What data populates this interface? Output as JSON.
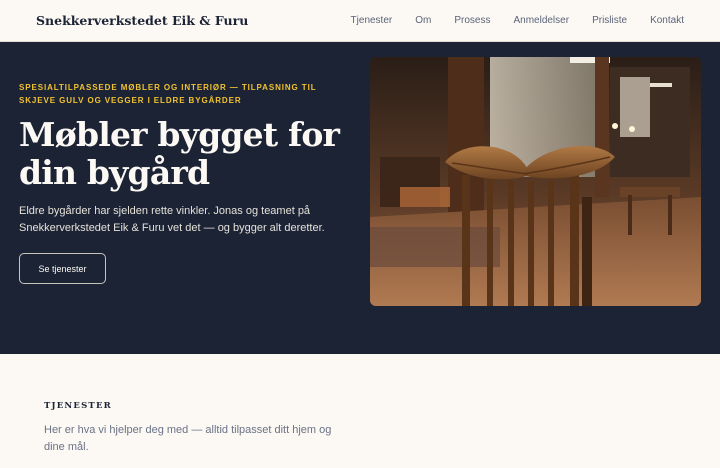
{
  "header": {
    "brand": "Snekkerverkstedet Eik & Furu",
    "nav": [
      "Tjenester",
      "Om",
      "Prosess",
      "Anmeldelser",
      "Prisliste",
      "Kontakt"
    ]
  },
  "hero": {
    "eyebrow": "SPESIALTILPASSEDE MØBLER OG INTERIØR — TILPASNING TIL SKJEVE GULV OG VEGGER I ELDRE BYGÅRDER",
    "headline": "Møbler bygget for din bygård",
    "lede": "Eldre bygårder har sjelden rette vinkler. Jonas og teamet på Snekkerverkstedet Eik & Furu vet det — og bygger alt deretter.",
    "cta": "Se tjenester"
  },
  "services": {
    "title": "TJENESTER",
    "lede": "Her er hva vi hjelper deg med — alltid tilpasset ditt hjem og dine mål."
  },
  "colors": {
    "navy": "#1b2335",
    "cream": "#fcf9f4",
    "accent": "#f2c230"
  }
}
